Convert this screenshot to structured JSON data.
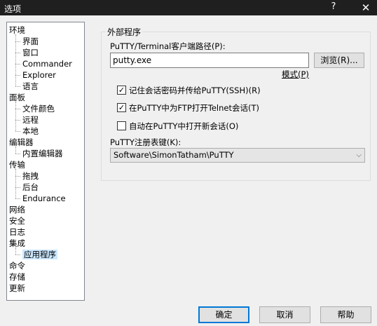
{
  "window": {
    "title": "选项",
    "help_glyph": "?",
    "close_glyph": "✕"
  },
  "tree": {
    "items": [
      {
        "label": "环境",
        "level": 0
      },
      {
        "label": "界面",
        "level": 1
      },
      {
        "label": "窗口",
        "level": 1
      },
      {
        "label": "Commander",
        "level": 1
      },
      {
        "label": "Explorer",
        "level": 1
      },
      {
        "label": "语言",
        "level": 1
      },
      {
        "label": "面板",
        "level": 0
      },
      {
        "label": "文件颜色",
        "level": 1
      },
      {
        "label": "远程",
        "level": 1
      },
      {
        "label": "本地",
        "level": 1
      },
      {
        "label": "编辑器",
        "level": 0
      },
      {
        "label": "内置编辑器",
        "level": 1
      },
      {
        "label": "传输",
        "level": 0
      },
      {
        "label": "拖拽",
        "level": 1
      },
      {
        "label": "后台",
        "level": 1
      },
      {
        "label": "Endurance",
        "level": 1
      },
      {
        "label": "网络",
        "level": 0
      },
      {
        "label": "安全",
        "level": 0
      },
      {
        "label": "日志",
        "level": 0
      },
      {
        "label": "集成",
        "level": 0
      },
      {
        "label": "应用程序",
        "level": 1,
        "selected": true
      },
      {
        "label": "命令",
        "level": 0
      },
      {
        "label": "存储",
        "level": 0
      },
      {
        "label": "更新",
        "level": 0
      }
    ]
  },
  "panel": {
    "group_title": "外部程序",
    "putty_path_label": "PuTTY/Terminal客户端路径(P):",
    "putty_path_value": "putty.exe",
    "browse_button": "浏览(R)...",
    "pattern_link": "模式(P)",
    "checkboxes": [
      {
        "label": "记住会话密码并传给PuTTY(SSH)(R)",
        "checked": true
      },
      {
        "label": "在PuTTY中为FTP打开Telnet会话(T)",
        "checked": true
      },
      {
        "label": "自动在PuTTY中打开新会话(O)",
        "checked": false
      }
    ],
    "registry_label": "PuTTY注册表键(K):",
    "registry_value": "Software\\SimonTatham\\PuTTY",
    "check_glyph": "✓"
  },
  "buttons": {
    "ok": "确定",
    "cancel": "取消",
    "help": "帮助"
  },
  "colors": {
    "selection": "#cce8ff",
    "titlebar": "#1f1f1f",
    "default_button_border": "#0078d7"
  }
}
